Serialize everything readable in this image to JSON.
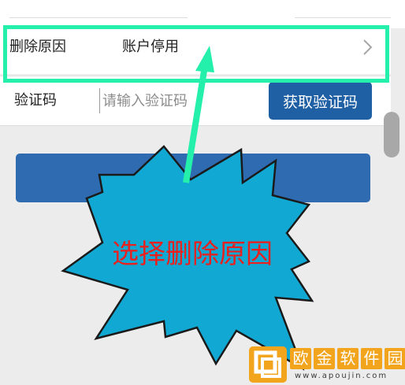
{
  "form": {
    "reason_label": "删除原因",
    "reason_value": "账户停用",
    "code_label": "验证码",
    "code_placeholder": "请输入验证码",
    "get_code_label": "获取验证码",
    "submit_label": ""
  },
  "annotation": {
    "callout_text": "选择删除原因"
  },
  "watermark": {
    "chars": [
      "欧",
      "金",
      "软",
      "件",
      "园"
    ],
    "url": "www.apoujin.com"
  },
  "colors": {
    "highlight": "#24f0ab",
    "primary_button": "#1f5fa3",
    "submit_button": "#2f6bb1",
    "callout_fill": "#11a9d3",
    "callout_text": "#e8201e",
    "watermark": "#f2a51c"
  },
  "icons": {
    "chevron": "chevron-right-icon",
    "logo": "watermark-logo-icon"
  }
}
